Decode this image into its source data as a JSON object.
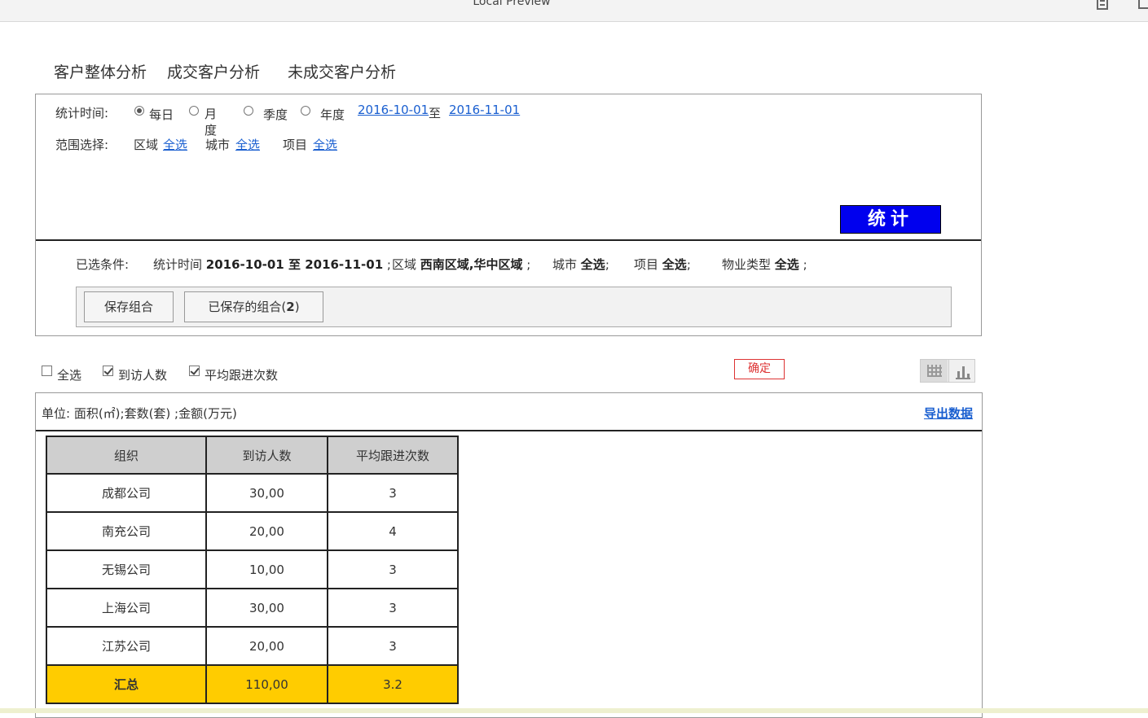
{
  "window": {
    "title": "Local Preview"
  },
  "tabs": [
    "客户整体分析",
    "成交客户分析",
    "未成交客户分析"
  ],
  "filters": {
    "time_label": "统计时间:",
    "periods": [
      {
        "label": "每日",
        "selected": true
      },
      {
        "label": "月度",
        "selected": false
      },
      {
        "label": "季度",
        "selected": false
      },
      {
        "label": "年度",
        "selected": false
      }
    ],
    "start_date": "2016-10-01",
    "to_label": "至",
    "end_date": "2016-11-01",
    "scope_label": "范围选择:",
    "scopes": [
      {
        "label": "区域",
        "link": "全选"
      },
      {
        "label": "城市",
        "link": "全选"
      },
      {
        "label": "项目",
        "link": "全选"
      }
    ],
    "stat_button": "统计"
  },
  "conditions": {
    "label": "已选条件:",
    "items": [
      {
        "key": "统计时间",
        "value": "2016-10-01 至 2016-11-01",
        "sep": ";"
      },
      {
        "key": "区域",
        "value": "西南区域,华中区域",
        "sep": ";"
      },
      {
        "key": "城市",
        "value": "全选",
        "sep": ";"
      },
      {
        "key": "项目",
        "value": "全选",
        "sep": ";"
      },
      {
        "key": "物业类型",
        "value": "全选",
        "sep": ";"
      }
    ],
    "save_button": "保存组合",
    "saved_button": "已保存的组合",
    "saved_count": "2"
  },
  "columns_select": {
    "options": [
      {
        "label": "全选",
        "checked": false
      },
      {
        "label": "到访人数",
        "checked": true
      },
      {
        "label": "平均跟进次数",
        "checked": true
      }
    ],
    "confirm": "确定",
    "view_icons": [
      "table-view-icon",
      "bar-chart-icon"
    ]
  },
  "result": {
    "unit": "单位: 面积(㎡);套数(套) ;金额(万元)",
    "export": "导出数据",
    "headers": [
      "组织",
      "到访人数",
      "平均跟进次数"
    ],
    "rows": [
      [
        "成都公司",
        "30,00",
        "3"
      ],
      [
        "南充公司",
        "20,00",
        "4"
      ],
      [
        "无锡公司",
        "10,00",
        "3"
      ],
      [
        "上海公司",
        "30,00",
        "3"
      ],
      [
        "江苏公司",
        "20,00",
        "3"
      ]
    ],
    "total": [
      "汇总",
      "110,00",
      "3.2"
    ]
  },
  "colors": {
    "stat_button": "#0000ee",
    "total_row": "#ffcc00",
    "link": "#1a5fd0",
    "confirm": "#dd3333"
  }
}
